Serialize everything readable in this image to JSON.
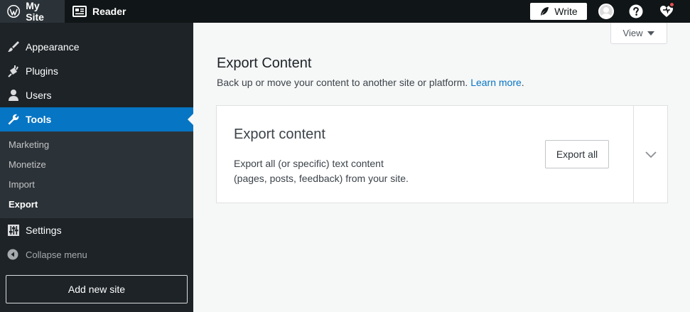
{
  "masterbar": {
    "my_site": "My Site",
    "reader": "Reader",
    "write": "Write"
  },
  "sidebar": {
    "items": [
      {
        "label": "Appearance",
        "icon": "paintbrush-icon"
      },
      {
        "label": "Plugins",
        "icon": "plugin-icon"
      },
      {
        "label": "Users",
        "icon": "user-icon"
      },
      {
        "label": "Tools",
        "icon": "wrench-icon"
      }
    ],
    "submenu": [
      "Marketing",
      "Monetize",
      "Import",
      "Export"
    ],
    "settings": "Settings",
    "collapse": "Collapse menu",
    "add_site": "Add new site"
  },
  "main": {
    "view_label": "View",
    "title": "Export Content",
    "subtitle": "Back up or move your content to another site or platform.",
    "learn_more": "Learn more",
    "learn_more_suffix": ".",
    "card": {
      "title": "Export content",
      "desc_line1": "Export all (or specific) text content",
      "desc_line2": "(pages, posts, feedback) from your site.",
      "button": "Export all"
    }
  },
  "colors": {
    "masterbar_bg": "#101517",
    "sidebar_bg": "#1d2327",
    "accent": "#0675c4",
    "page_bg": "#f6f7f7"
  }
}
